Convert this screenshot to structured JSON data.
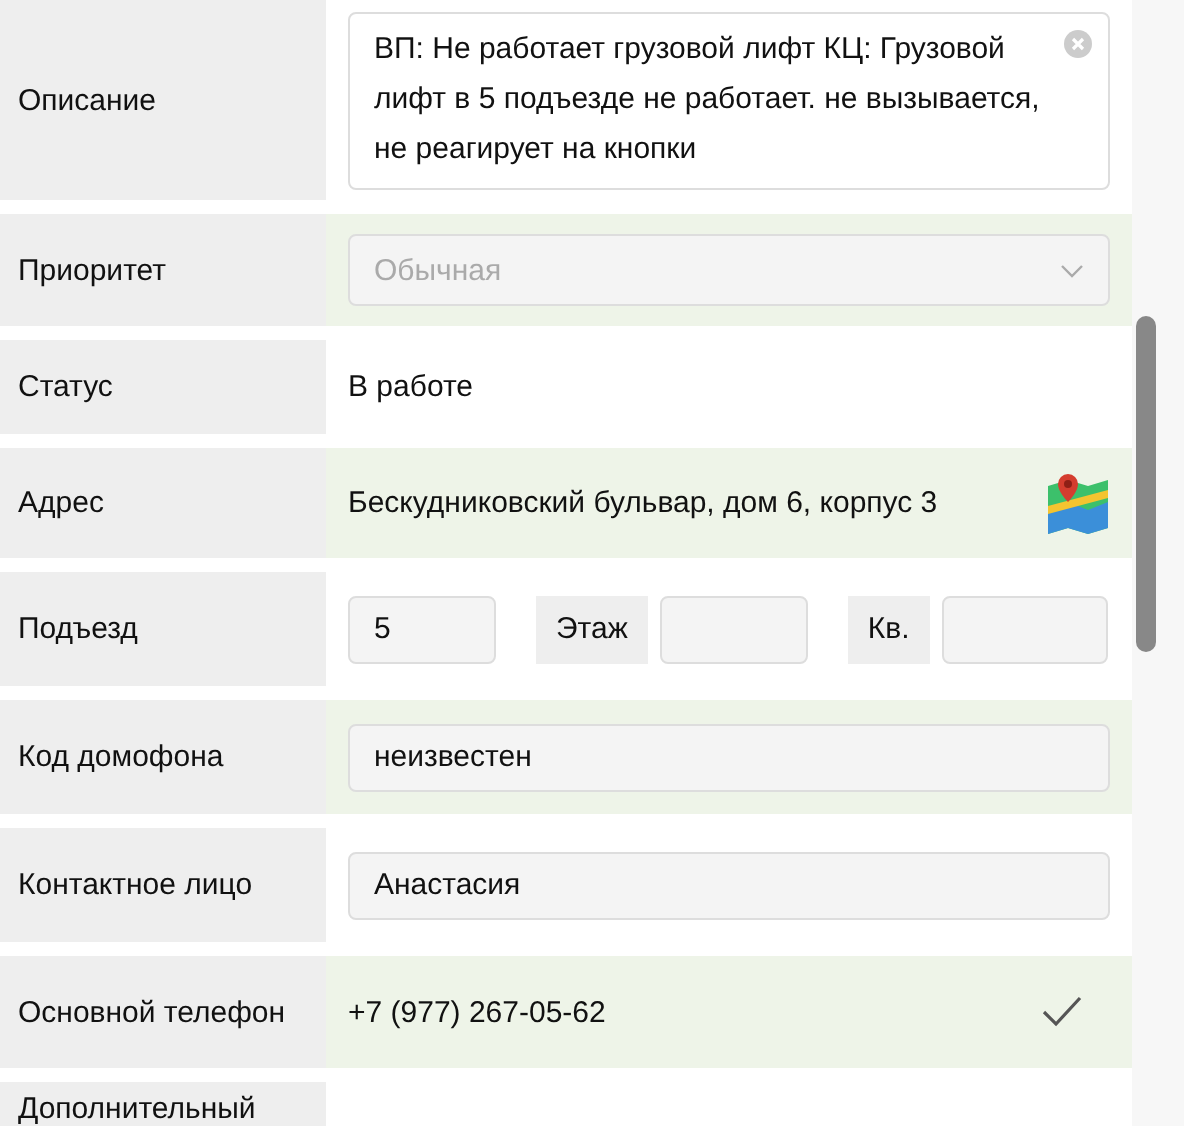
{
  "fields": [
    {
      "kind": "textarea",
      "label": "Описание",
      "value": "ВП: Не работает грузовой лифт КЦ: Грузовой лифт в 5 подъезде не работает. не вызывается, не реагирует на кнопки"
    },
    {
      "kind": "select",
      "label": "Приоритет",
      "value": "Обычная",
      "disabled": true
    },
    {
      "kind": "text",
      "label": "Статус",
      "value": "В работе"
    },
    {
      "kind": "address",
      "label": "Адрес",
      "value": "Бескудниковский бульвар, дом 6, корпус 3"
    },
    {
      "kind": "entrance",
      "label": "Подъезд",
      "value": "5",
      "parts": [
        {
          "label": "Этаж"
        },
        {
          "label": "Кв."
        }
      ]
    },
    {
      "kind": "input",
      "label": "Код домофона",
      "value": "неизвестен"
    },
    {
      "kind": "input",
      "label": "Контактное лицо",
      "value": "Анастасия"
    },
    {
      "kind": "phone",
      "label": "Основной телефон",
      "value": "+7 (977) 267-05-62",
      "confirmed": true
    },
    {
      "kind": "empty",
      "label": "Дополнительный"
    }
  ]
}
